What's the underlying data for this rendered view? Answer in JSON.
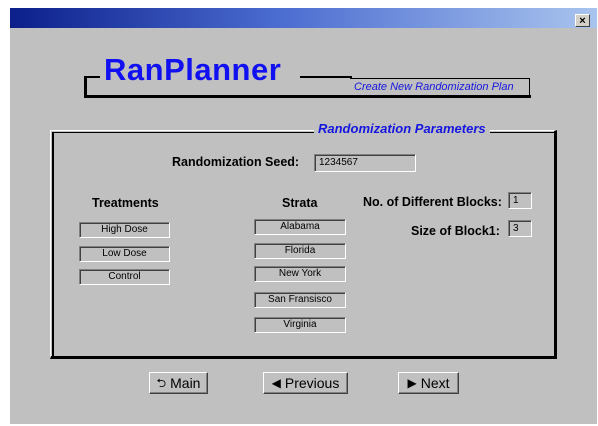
{
  "window": {
    "close_glyph": "×",
    "colors": {
      "background": "#c0c0c0",
      "titlebar_start": "#0c1f8a",
      "accent_blue": "#1515e0"
    }
  },
  "header": {
    "logo": "RanPlanner",
    "subtitle": "Create New Randomization Plan"
  },
  "params": {
    "section_title": "Randomization Parameters",
    "seed_label": "Randomization Seed:",
    "seed_value": "1234567",
    "treatments_heading": "Treatments",
    "treatments": [
      "High Dose",
      "Low Dose",
      "Control"
    ],
    "strata_heading": "Strata",
    "strata": [
      "Alabama",
      "Florida",
      "New York",
      "San Fransisco",
      "Virginia"
    ],
    "blocks_label": "No. of Different Blocks:",
    "blocks_value": "1",
    "block_size_label": "Size of Block1:",
    "block_size_value": "3"
  },
  "buttons": {
    "main": {
      "label": "Main",
      "icon": "return-arrow-icon",
      "glyph": "⮌"
    },
    "previous": {
      "label": "Previous",
      "icon": "left-arrow-icon",
      "glyph": "◀"
    },
    "next": {
      "label": "Next",
      "icon": "right-arrow-icon",
      "glyph": "▶"
    }
  }
}
